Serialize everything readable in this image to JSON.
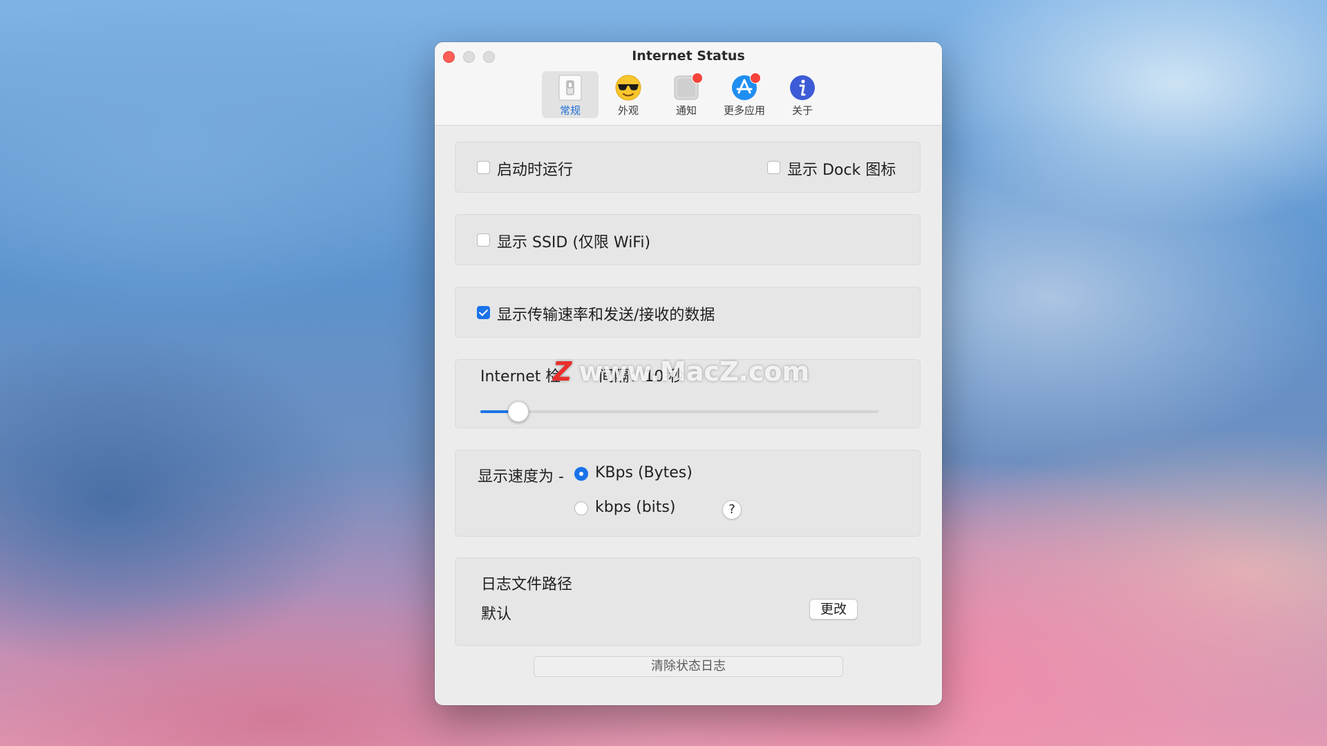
{
  "window": {
    "title": "Internet Status"
  },
  "tabs": [
    {
      "label": "常规",
      "icon": "toggle-switch-icon",
      "active": true
    },
    {
      "label": "外观",
      "icon": "sunglasses-emoji-icon",
      "active": false
    },
    {
      "label": "通知",
      "icon": "notification-icon",
      "active": false,
      "badge": true
    },
    {
      "label": "更多应用",
      "icon": "app-store-icon",
      "active": false,
      "badge": true
    },
    {
      "label": "关于",
      "icon": "info-icon",
      "active": false
    }
  ],
  "general": {
    "launch_at_login": {
      "label": "启动时运行",
      "checked": false
    },
    "show_dock_icon": {
      "label": "显示 Dock 图标",
      "checked": false
    },
    "show_ssid": {
      "label": "显示 SSID (仅限 WiFi)",
      "checked": false
    },
    "show_transfer": {
      "label": "显示传输速率和发送/接收的数据",
      "checked": true
    },
    "check_interval": {
      "label_prefix": "Internet 检",
      "label_suffix": "间隔：10 秒",
      "value_seconds": 10
    },
    "speed_unit": {
      "label": "显示速度为 -",
      "options": [
        "KBps (Bytes)",
        "kbps (bits)"
      ],
      "selected": "KBps (Bytes)",
      "help": "?"
    },
    "log_path": {
      "title": "日志文件路径",
      "value": "默认",
      "change_button": "更改"
    },
    "clear_log_button": "清除状态日志"
  },
  "watermark": {
    "logo": "Z",
    "text": "www.MacZ.com"
  },
  "colors": {
    "accent": "#1a73e8",
    "close": "#ff5f57",
    "badge": "#f5433a"
  }
}
